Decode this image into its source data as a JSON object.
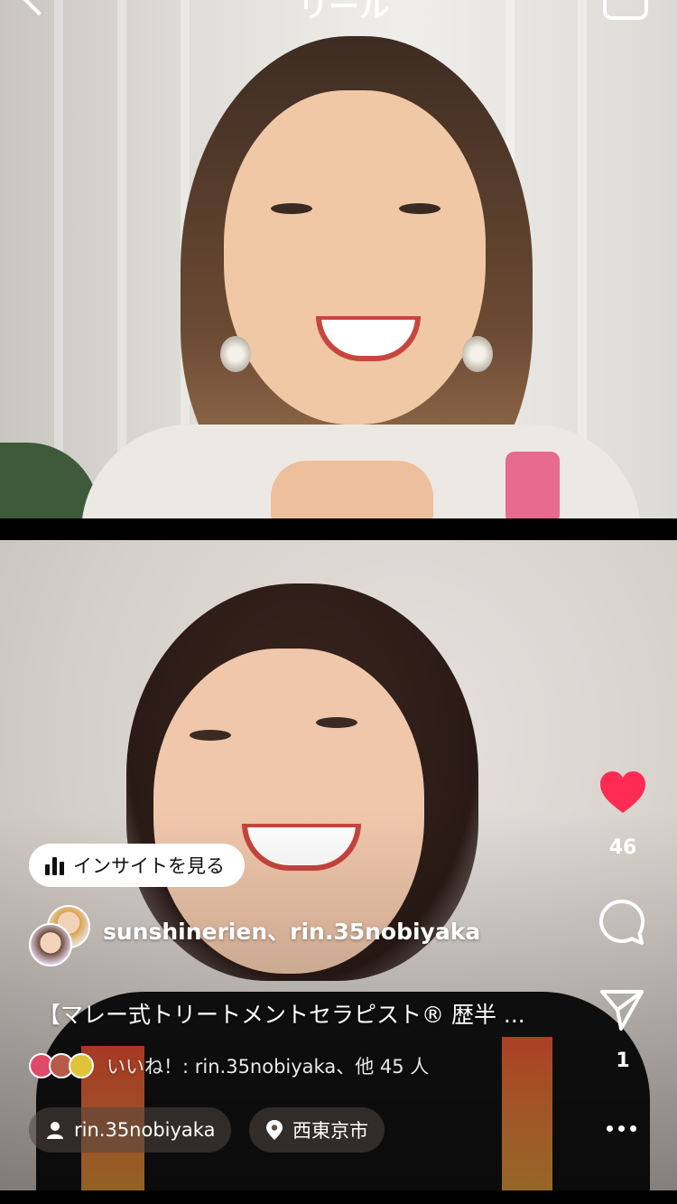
{
  "header": {
    "title": "リール"
  },
  "insight_button": {
    "label": "インサイトを見る"
  },
  "collaborators": {
    "names": "sunshinerien、rin.35nobiyaka"
  },
  "caption": {
    "text": "【マレー式トリートメントセラピスト® 歴半 ..."
  },
  "likes": {
    "text": "いいね！: rin.35nobiyaka、他 45 人"
  },
  "user_chip": {
    "label": "rin.35nobiyaka"
  },
  "location_chip": {
    "label": "西東京市"
  },
  "actions": {
    "like_count": "46",
    "share_count": "1"
  },
  "colors": {
    "heart": "#fe2c55",
    "pill_bg": "#ffffff"
  },
  "icons": [
    "back-icon",
    "camera-icon",
    "bar-chart-icon",
    "person-icon",
    "location-pin-icon",
    "heart-icon",
    "comment-icon",
    "share-icon",
    "more-icon"
  ]
}
